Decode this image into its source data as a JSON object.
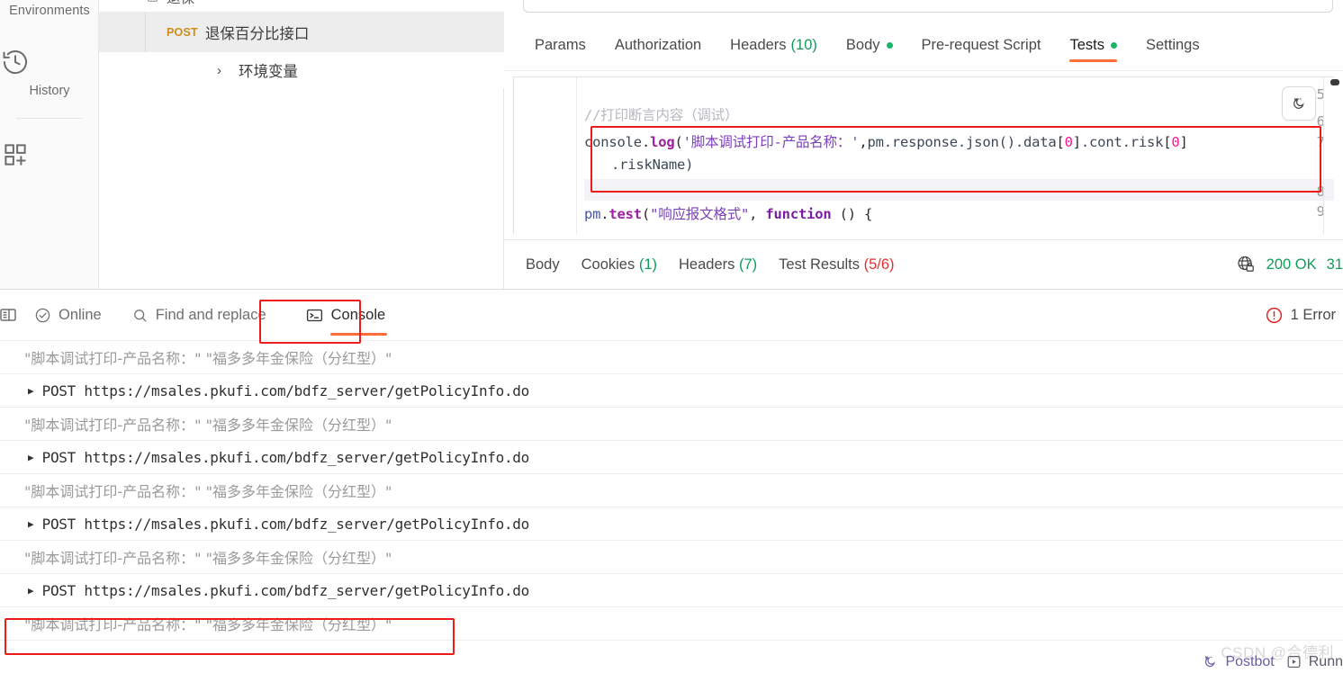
{
  "sidebar": {
    "environments_label": "Environments",
    "items": [
      {
        "label": "History",
        "icon": "history-clock-icon"
      },
      {
        "label": "",
        "icon": "apps-grid-add-icon"
      }
    ]
  },
  "request_list": {
    "selected": {
      "method": "POST",
      "name": "退保百分比接口"
    },
    "tree_item": {
      "label": "环境变量",
      "chevron": "›"
    }
  },
  "request_tabs": [
    {
      "label": "Params",
      "count": "",
      "dot": false,
      "active": false
    },
    {
      "label": "Authorization",
      "count": "",
      "dot": false,
      "active": false
    },
    {
      "label": "Headers",
      "count": "(10)",
      "dot": false,
      "active": false
    },
    {
      "label": "Body",
      "count": "",
      "dot": true,
      "active": false
    },
    {
      "label": "Pre-request Script",
      "count": "",
      "dot": false,
      "active": false
    },
    {
      "label": "Tests",
      "count": "",
      "dot": true,
      "active": true
    },
    {
      "label": "Settings",
      "count": "",
      "dot": false,
      "active": false
    }
  ],
  "editor": {
    "line_numbers": [
      "5",
      "6",
      "7",
      "8",
      "9"
    ],
    "line6_comment": "//打印断言内容（调试）",
    "line7": {
      "obj": "console",
      "dot1": ".",
      "fn": "log",
      "paren_open": "(",
      "str": "'脚本调试打印-产品名称：'",
      "comma": ",",
      "chain1": "pm.response.json().data",
      "br1_open": "[",
      "num1": "0",
      "br1_close": "]",
      "chain2": ".cont.risk",
      "br2_open": "[",
      "num2": "0",
      "br2_close": "]"
    },
    "line7_cont": ".riskName)",
    "line9": {
      "obj": "pm",
      "dot": ".",
      "fn": "test",
      "paren": "(",
      "str": "\"响应报文格式\"",
      "comma": ", ",
      "kw": "function",
      "tail": " () {"
    },
    "postbot_icon": "magic-wand-icon"
  },
  "response_tabs": [
    {
      "label": "Body",
      "count": "",
      "count_color": ""
    },
    {
      "label": "Cookies",
      "count": "(1)",
      "count_color": "green"
    },
    {
      "label": "Headers",
      "count": "(7)",
      "count_color": "green"
    },
    {
      "label": "Test Results",
      "count": "(5/6)",
      "count_color": "red"
    }
  ],
  "response_meta": {
    "globe_icon": "globe-lock-icon",
    "status": "200 OK",
    "time": "31"
  },
  "console_toolbar": {
    "sidebar_icon": "sidebar-toggle-icon",
    "online_label": "Online",
    "online_icon": "check-circle-icon",
    "find_label": "Find and replace",
    "find_icon": "search-icon",
    "console_label": "Console",
    "console_icon": "terminal-icon",
    "error_label": "1 Error",
    "error_icon": "error-circle-icon"
  },
  "console_logs": [
    {
      "type": "partial",
      "text": ""
    },
    {
      "type": "print",
      "text": "\"脚本调试打印-产品名称：\"   \"福多多年金保险（分红型）\""
    },
    {
      "type": "request",
      "method": "POST",
      "url": "https://msales.pkufi.com/bdfz_server/getPolicyInfo.do"
    },
    {
      "type": "print",
      "text": "\"脚本调试打印-产品名称：\"   \"福多多年金保险（分红型）\""
    },
    {
      "type": "request",
      "method": "POST",
      "url": "https://msales.pkufi.com/bdfz_server/getPolicyInfo.do"
    },
    {
      "type": "print",
      "text": "\"脚本调试打印-产品名称：\"   \"福多多年金保险（分红型）\""
    },
    {
      "type": "request",
      "method": "POST",
      "url": "https://msales.pkufi.com/bdfz_server/getPolicyInfo.do"
    },
    {
      "type": "print",
      "text": "\"脚本调试打印-产品名称：\"   \"福多多年金保险（分红型）\""
    },
    {
      "type": "request",
      "method": "POST",
      "url": "https://msales.pkufi.com/bdfz_server/getPolicyInfo.do"
    },
    {
      "type": "print",
      "text": "\"脚本调试打印-产品名称：\"   \"福多多年金保险（分红型）\"",
      "highlighted": true
    }
  ],
  "footer": {
    "postbot_label": "Postbot",
    "postbot_icon": "postbot-icon",
    "runner_label": "Runn",
    "runner_icon": "runner-icon",
    "watermark": "CSDN @合德利"
  },
  "colors": {
    "accent": "#ff6c37",
    "green": "#0f9d58",
    "red": "#e03131",
    "highlight_box": "#ee1b1b",
    "method_post": "#cf8c17"
  }
}
